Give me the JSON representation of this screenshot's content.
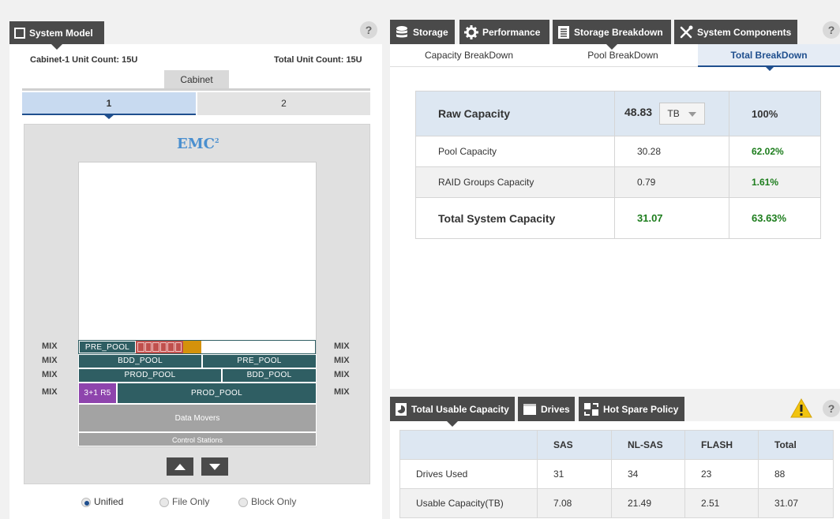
{
  "system_model": {
    "tab_label": "System Model",
    "cabinet_unit_count": "Cabinet-1 Unit Count: 15U",
    "total_unit_count": "Total Unit Count: 15U",
    "cabinet_label": "Cabinet",
    "cabinet_tabs": [
      "1",
      "2"
    ],
    "brand": "EMC",
    "brand_sup": "2",
    "rows": [
      {
        "left": "MIX",
        "right": "MIX"
      },
      {
        "left": "MIX",
        "right": "MIX"
      },
      {
        "left": "MIX",
        "right": "MIX"
      },
      {
        "left": "MIX",
        "right": "MIX"
      }
    ],
    "pools": {
      "r1_a": "PRE_POOL",
      "r2_a": "BDD_POOL",
      "r2_b": "PRE_POOL",
      "r3_a": "PROD_POOL",
      "r3_b": "BDD_POOL",
      "r4_a": "3+1 R5",
      "r4_b": "PROD_POOL"
    },
    "data_movers": "Data Movers",
    "control_stations": "Control Stations",
    "modes": [
      {
        "label": "Unified",
        "selected": true
      },
      {
        "label": "File Only",
        "selected": false
      },
      {
        "label": "Block Only",
        "selected": false
      }
    ]
  },
  "top_tabs": {
    "storage": "Storage",
    "performance": "Performance",
    "storage_breakdown": "Storage Breakdown",
    "system_components": "System Components"
  },
  "sub_tabs": [
    "Capacity BreakDown",
    "Pool BreakDown",
    "Total BreakDown"
  ],
  "capacity_table": {
    "raw": {
      "label": "Raw Capacity",
      "value": "48.83",
      "unit": "TB",
      "percent": "100%"
    },
    "rows": [
      {
        "label": "Pool Capacity",
        "value": "30.28",
        "percent": "62.02%"
      },
      {
        "label": "RAID Groups Capacity",
        "value": "0.79",
        "percent": "1.61%"
      }
    ],
    "total": {
      "label": "Total System Capacity",
      "value": "31.07",
      "percent": "63.63%"
    }
  },
  "bottom_tabs": {
    "usable": "Total Usable Capacity",
    "drives": "Drives",
    "hot_spare": "Hot Spare Policy"
  },
  "drive_table": {
    "headers": [
      "",
      "SAS",
      "NL-SAS",
      "FLASH",
      "Total"
    ],
    "rows": [
      [
        "Drives Used",
        "31",
        "34",
        "23",
        "88"
      ],
      [
        "Usable Capacity(TB)",
        "7.08",
        "21.49",
        "2.51",
        "31.07"
      ]
    ]
  },
  "help_symbol": "?",
  "colors": {
    "pool": "#2f5e63",
    "raid": "#8e44ad",
    "ssd": "#c0504d",
    "accent": "#d4920b",
    "green": "#1d7d1d"
  }
}
